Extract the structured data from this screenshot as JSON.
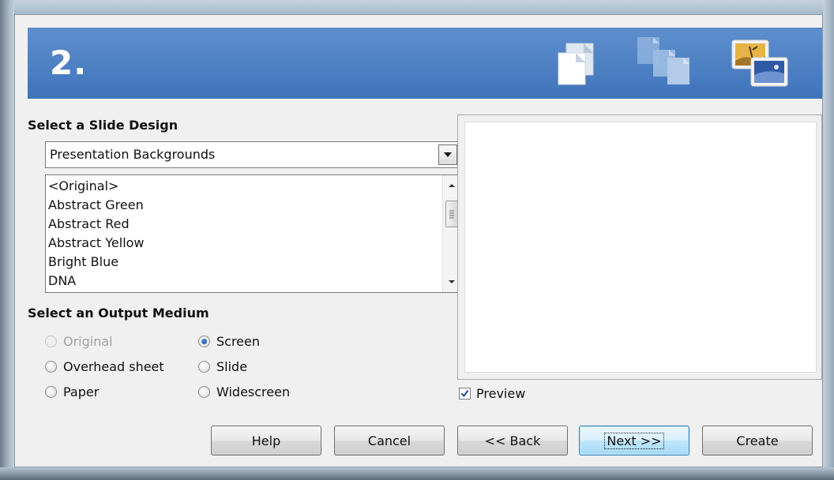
{
  "header": {
    "step": "2."
  },
  "design": {
    "section_label": "Select a Slide Design",
    "dropdown_value": "Presentation Backgrounds",
    "list_items": [
      "<Original>",
      "Abstract Green",
      "Abstract Red",
      "Abstract Yellow",
      "Bright Blue",
      "DNA"
    ]
  },
  "output": {
    "section_label": "Select an Output Medium",
    "options": [
      {
        "label": "Original",
        "checked": false,
        "disabled": true
      },
      {
        "label": "Screen",
        "checked": true,
        "disabled": false
      },
      {
        "label": "Overhead sheet",
        "checked": false,
        "disabled": false
      },
      {
        "label": "Slide",
        "checked": false,
        "disabled": false
      },
      {
        "label": "Paper",
        "checked": false,
        "disabled": false
      },
      {
        "label": "Widescreen",
        "checked": false,
        "disabled": false
      }
    ]
  },
  "preview": {
    "checkbox_label": "Preview",
    "checked": true
  },
  "buttons": {
    "help": "Help",
    "cancel": "Cancel",
    "back": "<< Back",
    "next": "Next >>",
    "create": "Create"
  },
  "colors": {
    "banner": "#4a7fc4",
    "accent": "#3c7fb1"
  }
}
